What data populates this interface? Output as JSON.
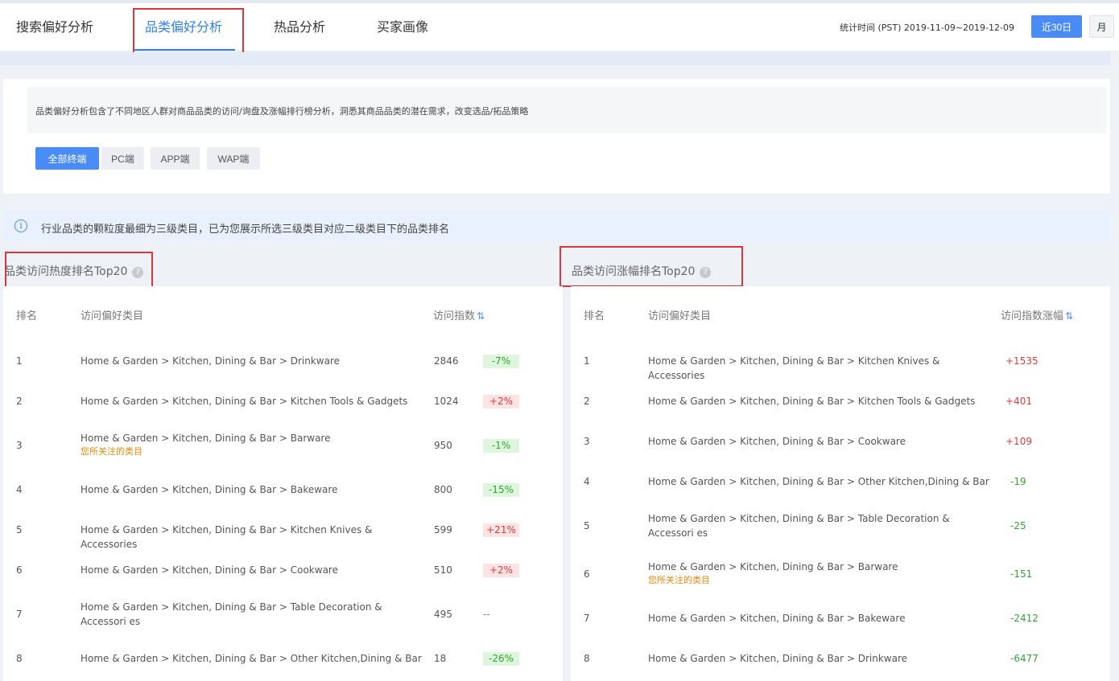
{
  "tabs": [
    {
      "label": "搜索偏好分析"
    },
    {
      "label": "品类偏好分析"
    },
    {
      "label": "热品分析"
    },
    {
      "label": "买家画像"
    }
  ],
  "date_range": "统计时间 (PST) 2019-11-09~2019-12-09",
  "period_buttons": {
    "last30": "近30日",
    "month": "月"
  },
  "description": "品类偏好分析包含了不同地区人群对商品品类的访问/询盘及涨幅排行榜分析，洞悉其商品品类的潜在需求，改变选品/拓品策略",
  "filters": [
    "全部终端",
    "PC端",
    "APP端",
    "WAP端"
  ],
  "notice": "行业品类的颗粒度最细为三级类目，已为您展示所选三级类目对应二级类目下的品类排名",
  "notice_icon": "info-icon",
  "left_table": {
    "title": "品类访问热度排名Top20",
    "headers": {
      "rank": "排名",
      "category": "访问偏好类目",
      "metric": "访问指数"
    },
    "rows": [
      {
        "rank": "1",
        "category": "Home & Garden > Kitchen, Dining & Bar > Drinkware",
        "favorite": "",
        "value": "2846",
        "change": "-7%",
        "dir": "down"
      },
      {
        "rank": "2",
        "category": "Home & Garden > Kitchen, Dining & Bar > Kitchen Tools & Gadgets",
        "favorite": "",
        "value": "1024",
        "change": "+2%",
        "dir": "up"
      },
      {
        "rank": "3",
        "category": "Home & Garden > Kitchen, Dining & Bar > Barware",
        "favorite": "您所关注的类目",
        "value": "950",
        "change": "-1%",
        "dir": "down"
      },
      {
        "rank": "4",
        "category": "Home & Garden > Kitchen, Dining & Bar > Bakeware",
        "favorite": "",
        "value": "800",
        "change": "-15%",
        "dir": "down"
      },
      {
        "rank": "5",
        "category": "Home & Garden > Kitchen, Dining & Bar > Kitchen Knives & Accessories",
        "favorite": "",
        "value": "599",
        "change": "+21%",
        "dir": "up"
      },
      {
        "rank": "6",
        "category": "Home & Garden > Kitchen, Dining & Bar > Cookware",
        "favorite": "",
        "value": "510",
        "change": "+2%",
        "dir": "up"
      },
      {
        "rank": "7",
        "category": "Home & Garden > Kitchen, Dining & Bar > Table Decoration & Accessori es",
        "favorite": "",
        "value": "495",
        "change": "--",
        "dir": "none"
      },
      {
        "rank": "8",
        "category": "Home & Garden > Kitchen, Dining & Bar > Other Kitchen,Dining & Bar",
        "favorite": "",
        "value": "18",
        "change": "-26%",
        "dir": "down"
      }
    ]
  },
  "right_table": {
    "title": "品类访问涨幅排名Top20",
    "headers": {
      "rank": "排名",
      "category": "访问偏好类目",
      "metric": "访问指数涨幅"
    },
    "rows": [
      {
        "rank": "1",
        "category": "Home & Garden > Kitchen, Dining & Bar > Kitchen Knives & Accessories",
        "favorite": "",
        "change": "+1535",
        "dir": "up"
      },
      {
        "rank": "2",
        "category": "Home & Garden > Kitchen, Dining & Bar > Kitchen Tools & Gadgets",
        "favorite": "",
        "change": "+401",
        "dir": "up"
      },
      {
        "rank": "3",
        "category": "Home & Garden > Kitchen, Dining & Bar > Cookware",
        "favorite": "",
        "change": "+109",
        "dir": "up"
      },
      {
        "rank": "4",
        "category": "Home & Garden > Kitchen, Dining & Bar > Other Kitchen,Dining & Bar",
        "favorite": "",
        "change": "-19",
        "dir": "down"
      },
      {
        "rank": "5",
        "category": "Home & Garden > Kitchen, Dining & Bar > Table Decoration & Accessori es",
        "favorite": "",
        "change": "-25",
        "dir": "down"
      },
      {
        "rank": "6",
        "category": "Home & Garden > Kitchen, Dining & Bar > Barware",
        "favorite": "您所关注的类目",
        "change": "-151",
        "dir": "down"
      },
      {
        "rank": "7",
        "category": "Home & Garden > Kitchen, Dining & Bar > Bakeware",
        "favorite": "",
        "change": "-2412",
        "dir": "down"
      },
      {
        "rank": "8",
        "category": "Home & Garden > Kitchen, Dining & Bar > Drinkware",
        "favorite": "",
        "change": "-6477",
        "dir": "down"
      }
    ]
  },
  "colors": {
    "accent": "#4a8cf7",
    "up": "#e03a3a",
    "down": "#34a534",
    "favorite": "#e8890c",
    "highlight_box": "#d9363e"
  }
}
